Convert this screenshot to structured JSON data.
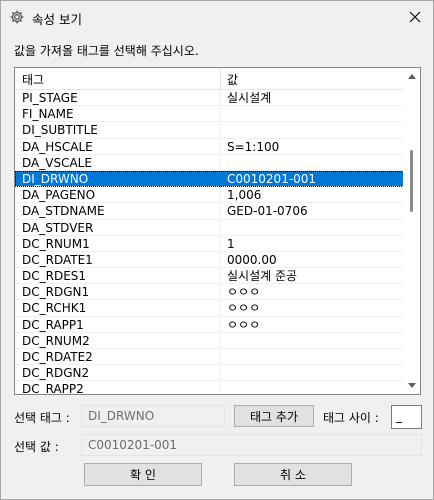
{
  "window": {
    "title": "속성 보기",
    "icon": "gear-icon"
  },
  "instruction": "값을 가져올 태그를 선택해 주십시오.",
  "table": {
    "columns": [
      "태그",
      "값"
    ],
    "rows": [
      {
        "tag": "PI_STAGE",
        "value": "실시설계"
      },
      {
        "tag": "FI_NAME",
        "value": ""
      },
      {
        "tag": "DI_SUBTITLE",
        "value": ""
      },
      {
        "tag": "DA_HSCALE",
        "value": "S=1:100"
      },
      {
        "tag": "DA_VSCALE",
        "value": ""
      },
      {
        "tag": "DI_DRWNO",
        "value": "C0010201-001"
      },
      {
        "tag": "DA_PAGENO",
        "value": "1,006"
      },
      {
        "tag": "DA_STDNAME",
        "value": "GED-01-0706"
      },
      {
        "tag": "DA_STDVER",
        "value": ""
      },
      {
        "tag": "DC_RNUM1",
        "value": "1"
      },
      {
        "tag": "DC_RDATE1",
        "value": "0000.00"
      },
      {
        "tag": "DC_RDES1",
        "value": "실시설계 준공"
      },
      {
        "tag": "DC_RDGN1",
        "value": "ㅇㅇㅇ"
      },
      {
        "tag": "DC_RCHK1",
        "value": "ㅇㅇㅇ"
      },
      {
        "tag": "DC_RAPP1",
        "value": "ㅇㅇㅇ"
      },
      {
        "tag": "DC_RNUM2",
        "value": ""
      },
      {
        "tag": "DC_RDATE2",
        "value": ""
      },
      {
        "tag": "DC_RDGN2",
        "value": ""
      },
      {
        "tag": "DC_RAPP2",
        "value": ""
      }
    ],
    "selected_tag": "DI_DRWNO",
    "selection_color": "#0078d7"
  },
  "selected_tag": {
    "label": "선택 태그 :",
    "value": "DI_DRWNO"
  },
  "add_tag_button": "태그 추가",
  "separator": {
    "label": "태그 사이 :",
    "value": "_"
  },
  "selected_value": {
    "label": "선택 값 :",
    "value": "C0010201-001"
  },
  "ok_button": "확 인",
  "cancel_button": "취 소"
}
